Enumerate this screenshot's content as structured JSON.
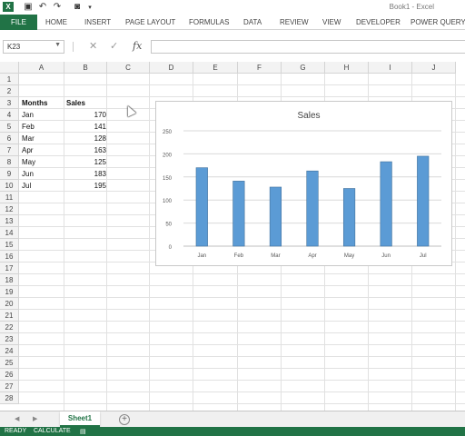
{
  "window": {
    "title": "Book1 - Excel",
    "app_icon": "X"
  },
  "quick_access": [
    {
      "name": "save-icon",
      "glyph": "💾"
    },
    {
      "name": "undo-icon",
      "glyph": "↶"
    },
    {
      "name": "redo-icon",
      "glyph": "↷"
    },
    {
      "name": "camera-icon",
      "glyph": "📷"
    },
    {
      "name": "customize-icon",
      "glyph": "▾"
    }
  ],
  "ribbon": {
    "file_label": "FILE",
    "tabs": [
      "HOME",
      "INSERT",
      "PAGE LAYOUT",
      "FORMULAS",
      "DATA",
      "REVIEW",
      "VIEW",
      "DEVELOPER",
      "POWER QUERY"
    ]
  },
  "formula_bar": {
    "name_box": "K23",
    "fx_label": "fx",
    "value": ""
  },
  "columns": [
    "A",
    "B",
    "C",
    "D",
    "E",
    "F",
    "G",
    "H",
    "I",
    "J"
  ],
  "rows": [
    "1",
    "2",
    "3",
    "4",
    "5",
    "6",
    "7",
    "8",
    "9",
    "10",
    "11",
    "12",
    "13",
    "14",
    "15",
    "16",
    "17",
    "18",
    "19",
    "20",
    "21",
    "22",
    "23",
    "24",
    "25",
    "26",
    "27",
    "28"
  ],
  "table": {
    "header_months": "Months",
    "header_sales": "Sales",
    "rows": [
      {
        "month": "Jan",
        "sales": "170"
      },
      {
        "month": "Feb",
        "sales": "141"
      },
      {
        "month": "Mar",
        "sales": "128"
      },
      {
        "month": "Apr",
        "sales": "163"
      },
      {
        "month": "May",
        "sales": "125"
      },
      {
        "month": "Jun",
        "sales": "183"
      },
      {
        "month": "Jul",
        "sales": "195"
      }
    ]
  },
  "chart_data": {
    "type": "bar",
    "title": "Sales",
    "categories": [
      "Jan",
      "Feb",
      "Mar",
      "Apr",
      "May",
      "Jun",
      "Jul"
    ],
    "values": [
      170,
      141,
      128,
      163,
      125,
      183,
      195
    ],
    "yticks": [
      "0",
      "50",
      "100",
      "150",
      "200",
      "250"
    ],
    "ylim": [
      0,
      250
    ],
    "grid": true,
    "legend": "none",
    "bar_color": "#5b9bd5"
  },
  "sheets": {
    "active": "Sheet1",
    "add_label": "+"
  },
  "status": {
    "ready": "READY",
    "calculate": "CALCULATE"
  },
  "colors": {
    "excel_green": "#217346"
  }
}
